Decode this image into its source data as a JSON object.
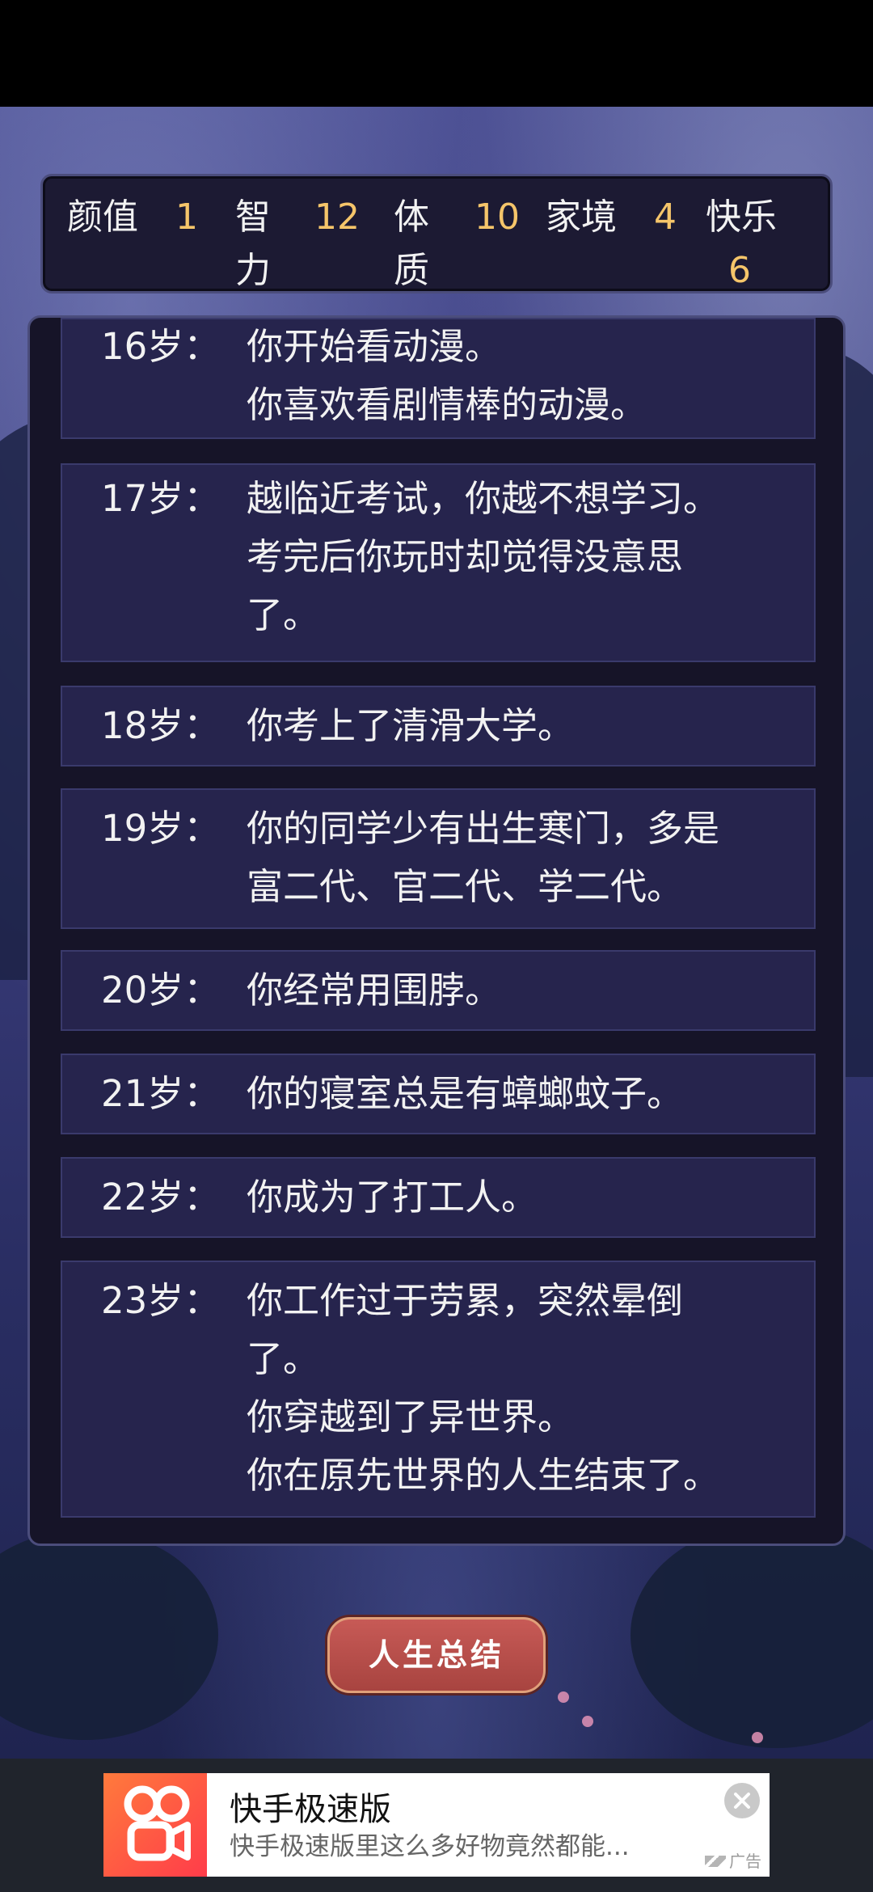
{
  "attributes": [
    {
      "label": "颜值",
      "value": "1"
    },
    {
      "label": "智力",
      "value": "12"
    },
    {
      "label": "体质",
      "value": "10"
    },
    {
      "label": "家境",
      "value": "4"
    },
    {
      "label": "快乐",
      "value": "6"
    }
  ],
  "events": [
    {
      "age": "16岁：",
      "lines": [
        "你开始看动漫。",
        "你喜欢看剧情棒的动漫。"
      ]
    },
    {
      "age": "17岁：",
      "lines": [
        "越临近考试，你越不想学习。",
        "考完后你玩时却觉得没意思",
        "了。"
      ]
    },
    {
      "age": "18岁：",
      "lines": [
        "你考上了清滑大学。"
      ]
    },
    {
      "age": "19岁：",
      "lines": [
        "你的同学少有出生寒门，多是",
        "富二代、官二代、学二代。"
      ]
    },
    {
      "age": "20岁：",
      "lines": [
        "你经常用围脖。"
      ]
    },
    {
      "age": "21岁：",
      "lines": [
        "你的寝室总是有蟑螂蚊子。"
      ]
    },
    {
      "age": "22岁：",
      "lines": [
        "你成为了打工人。"
      ]
    },
    {
      "age": "23岁：",
      "lines": [
        "你工作过于劳累，突然晕倒",
        "了。",
        "你穿越到了异世界。",
        "你在原先世界的人生结束了。"
      ]
    }
  ],
  "summary_button": "人生总结",
  "ad": {
    "title": "快手极速版",
    "subtitle": "快手极速版里这么多好物竟然都能...",
    "tag": "广告",
    "brand_color": "#ff4a3c"
  },
  "colors": {
    "value_accent": "#f5c56a",
    "card_bg": "#26244d",
    "button_bg": "#b84c48"
  }
}
